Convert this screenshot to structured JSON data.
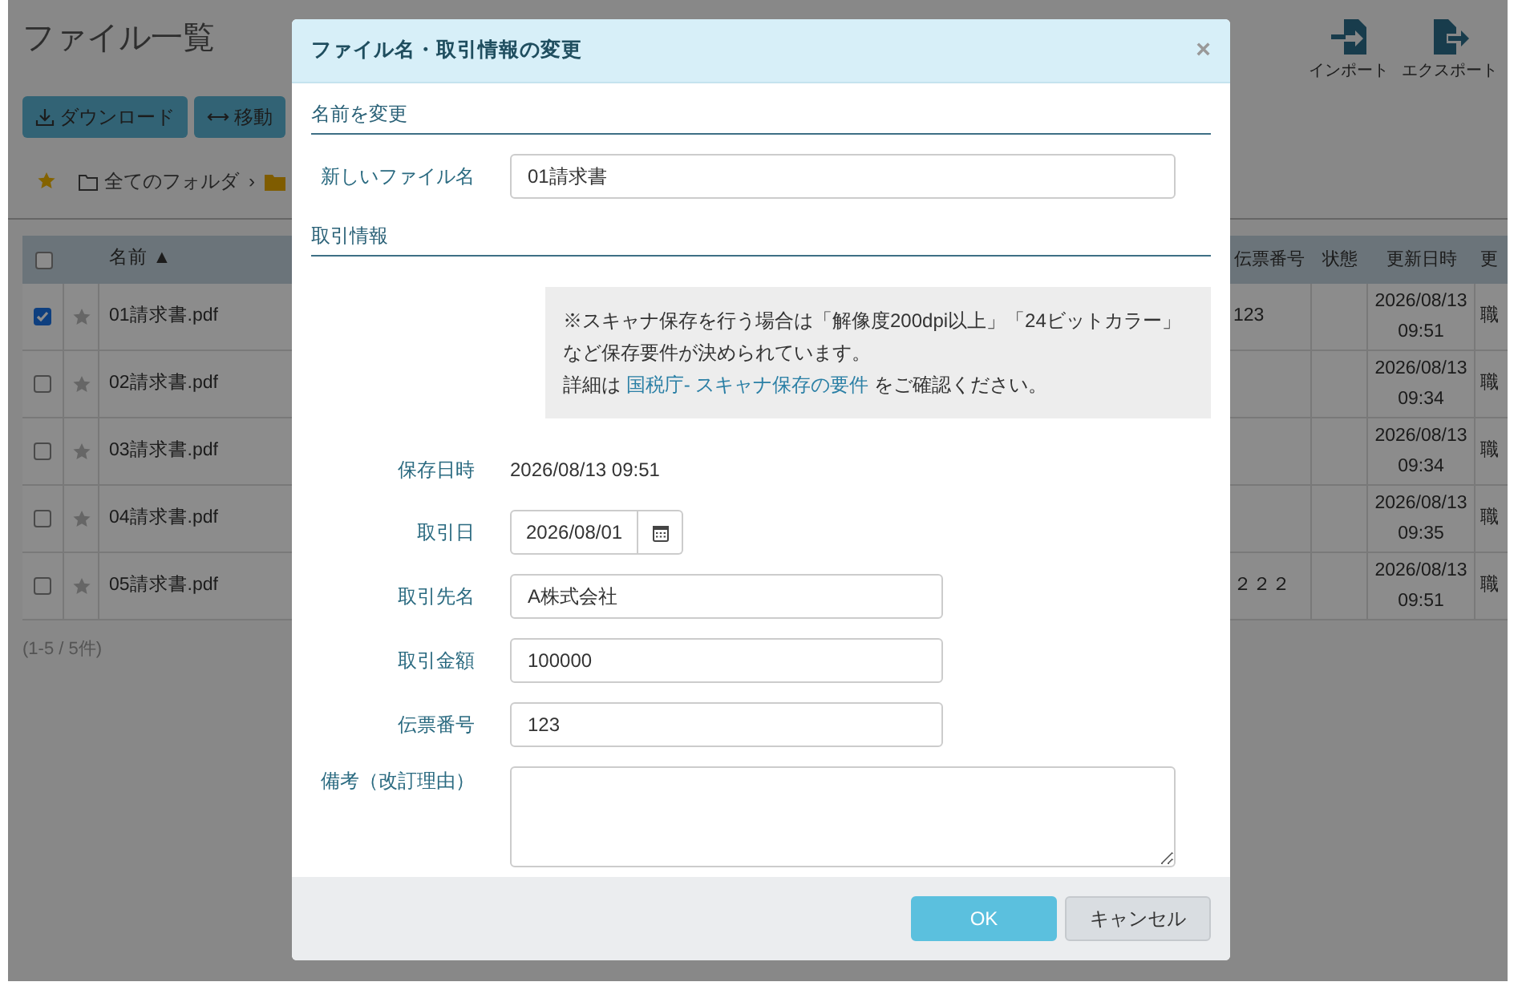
{
  "page": {
    "title": "ファイル一覧",
    "buttons": [
      {
        "label": "ダウンロード",
        "kind": "download"
      },
      {
        "label": "移動",
        "kind": "move"
      }
    ],
    "breadcrumb": {
      "root": "全てのフォルダ",
      "separator": "›"
    },
    "toolbar": [
      {
        "label": "インポート",
        "kind": "import"
      },
      {
        "label": "エクスポート",
        "kind": "export"
      }
    ],
    "table": {
      "select_all_checked": false,
      "header": {
        "name": "名前 ▲",
        "slip_number": "伝票番号",
        "status": "状態",
        "updated": "更新日時",
        "column_7": "更"
      },
      "rows": [
        {
          "checked": true,
          "starred": false,
          "name": "01請求書.pdf",
          "slip_number": "123",
          "updated": "2026/08/13 09:51",
          "column_7": "職"
        },
        {
          "checked": false,
          "starred": false,
          "name": "02請求書.pdf",
          "updated": "2026/08/13 09:34",
          "column_7": "職"
        },
        {
          "checked": false,
          "starred": false,
          "name": "03請求書.pdf",
          "updated": "2026/08/13 09:34",
          "column_7": "職"
        },
        {
          "checked": false,
          "starred": false,
          "name": "04請求書.pdf",
          "updated": "2026/08/13 09:35",
          "column_7": "職"
        },
        {
          "checked": false,
          "starred": false,
          "name": "05請求書.pdf",
          "slip_number": "２２２",
          "updated": "2026/08/13 09:51",
          "column_7": "職"
        }
      ]
    },
    "count": "(1-5 / 5件)"
  },
  "dialog": {
    "title": "ファイル名・取引情報の変更",
    "close": "×",
    "rename_section": "名前を変更",
    "file_name": {
      "label": "新しいファイル名",
      "value": "01請求書"
    },
    "deal_section": "取引情報",
    "notice": {
      "text": "※スキャナ保存を行う場合は「解像度200dpi以上」「24ビットカラー」など保存要件が決められています。",
      "detail_prefix": "詳細は",
      "link": "国税庁- スキャナ保存の要件",
      "detail_suffix": "をご確認ください。"
    },
    "saved_at": {
      "label": "保存日時",
      "value": "2026/08/13 09:51"
    },
    "fields": [
      {
        "kind": "date",
        "label": "取引日",
        "value": "2026/08/01"
      },
      {
        "kind": "text",
        "label": "取引先名",
        "value": "A株式会社"
      },
      {
        "kind": "text",
        "label": "取引金額",
        "value": "100000"
      },
      {
        "kind": "text",
        "label": "伝票番号",
        "value": "123"
      },
      {
        "kind": "textarea",
        "label": "備考（改訂理由）"
      }
    ],
    "buttons": [
      {
        "label": "OK",
        "kind": "primary"
      },
      {
        "label": "キャンセル",
        "kind": "secondary"
      }
    ]
  }
}
